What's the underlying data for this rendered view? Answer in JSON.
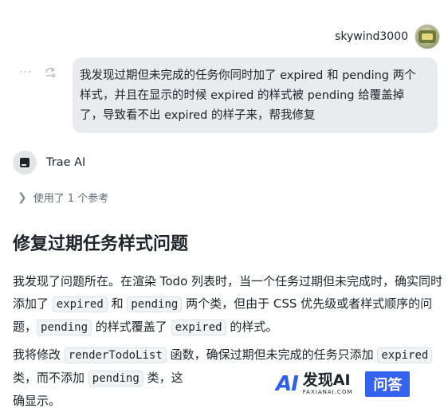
{
  "user": {
    "name": "skywind3000",
    "message": "我发现过期但未完成的任务你同时加了 expired 和 pending 两个样式，并且在显示的时候 expired 的样式被 pending 给覆盖掉了，导致看不出 expired 的样子来，帮我修复"
  },
  "assistant": {
    "name": "Trae AI",
    "refs_label": "使用了 1 个参考"
  },
  "content": {
    "heading": "修复过期任务样式问题",
    "p1": {
      "t1": "我发现了问题所在。在渲染 Todo 列表时，当一个任务过期但未完成时，确实同时添加了 ",
      "c1": "expired",
      "t2": " 和 ",
      "c2": "pending",
      "t3": " 两个类，但由于 CSS 优先级或者样式顺序的问题，",
      "c3": "pending",
      "t4": " 的样式覆盖了 ",
      "c4": "expired",
      "t5": " 的样式。"
    },
    "p2": {
      "t1": "我将修改 ",
      "c1": "renderTodoList",
      "t2": " 函数，确保过期但未完成的任务只添加 ",
      "c2": "expired",
      "t3": " 类，而不添加 ",
      "c3": "pending",
      "t4": " 类，这",
      "t5": "确显示。"
    }
  },
  "watermark": {
    "logo": "AI",
    "brand": "发现AI",
    "domain": "FAXIANAI.COM",
    "badge": "问答"
  },
  "icons": {
    "more": "more-icon",
    "share": "share-icon",
    "expand": "chevron-right-icon"
  }
}
